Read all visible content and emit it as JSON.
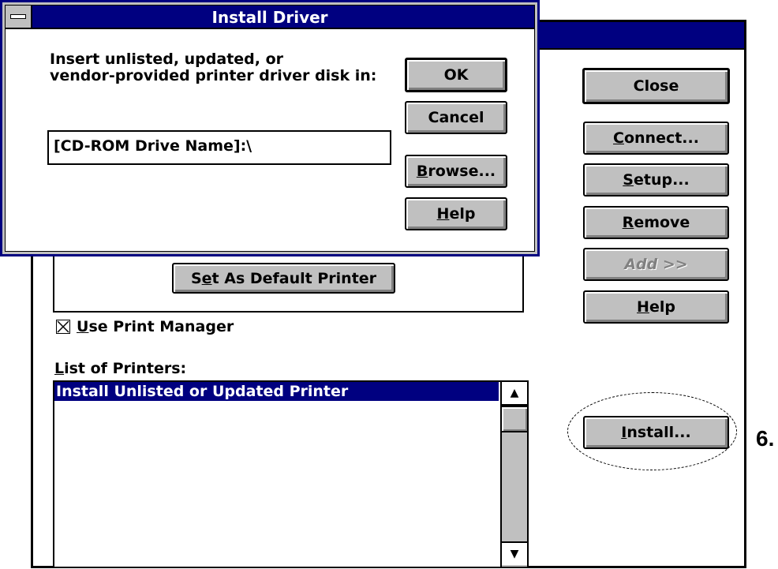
{
  "main_window": {
    "set_default_button": {
      "pre": "S",
      "accel": "e",
      "post": "t As Default Printer"
    },
    "use_print_manager": {
      "accel": "U",
      "rest": "se Print Manager",
      "checked": true
    },
    "list_label": {
      "accel": "L",
      "rest": "ist of Printers:"
    },
    "printers": [
      "Install Unlisted or Updated Printer"
    ],
    "buttons": {
      "close": "Close",
      "connect": {
        "accel": "C",
        "rest": "onnect..."
      },
      "setup": {
        "accel": "S",
        "rest": "etup..."
      },
      "remove": {
        "accel": "R",
        "rest": "emove"
      },
      "add": {
        "accel": "A",
        "rest": "dd >>"
      },
      "help": {
        "accel": "H",
        "rest": "elp"
      },
      "install": {
        "accel": "I",
        "rest": "nstall..."
      }
    }
  },
  "dialog": {
    "title": "Install Driver",
    "prompt_line1": "Insert unlisted, updated, or",
    "prompt_line2": "vendor-provided printer driver disk in:",
    "path_value": "[CD-ROM Drive Name]:\\",
    "buttons": {
      "ok": "OK",
      "cancel": "Cancel",
      "browse": {
        "accel": "B",
        "rest": "rowse..."
      },
      "help": {
        "accel": "H",
        "rest": "elp"
      }
    }
  },
  "annotation": {
    "step_label": "6."
  },
  "colors": {
    "titlebar": "#000080",
    "button_face": "#c0c0c0",
    "selection": "#000080"
  },
  "icons": [
    "system-menu-icon",
    "checkbox-checked-icon",
    "scroll-up-arrow-icon",
    "scroll-down-arrow-icon"
  ]
}
